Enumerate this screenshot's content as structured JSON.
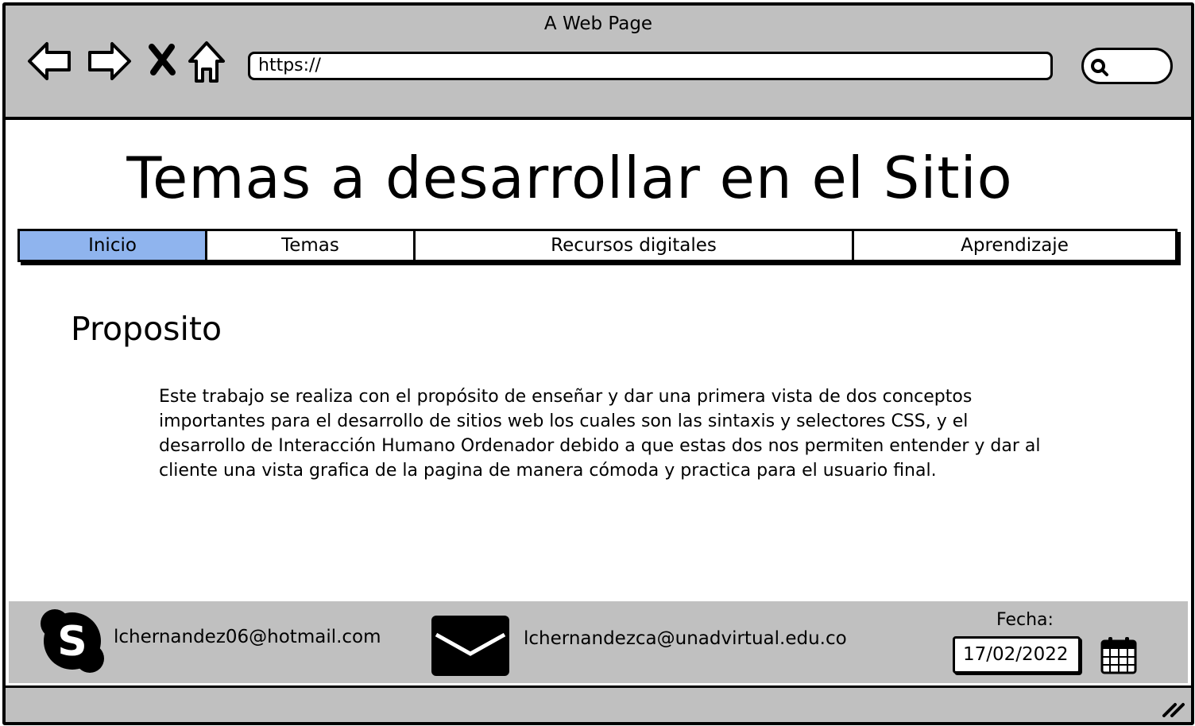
{
  "window": {
    "title": "A Web Page"
  },
  "browser": {
    "url": "https://",
    "icons": [
      "back-arrow-icon",
      "forward-arrow-icon",
      "close-x-icon",
      "home-icon",
      "search-icon"
    ]
  },
  "page": {
    "title": "Temas a desarrollar en el Sitio",
    "tabs": [
      {
        "label": "Inicio",
        "active": true
      },
      {
        "label": "Temas",
        "active": false
      },
      {
        "label": "Recursos digitales",
        "active": false
      },
      {
        "label": "Aprendizaje",
        "active": false
      }
    ],
    "section_heading": "Proposito",
    "paragraph": "Este trabajo se realiza con el propósito de enseñar y dar una primera vista de dos conceptos importantes para el desarrollo de sitios web los cuales son las sintaxis y selectores CSS, y el desarrollo de Interacción Humano Ordenador  debido a que estas dos nos permiten entender y dar al cliente una vista grafica de la pagina de manera cómoda y practica para el usuario final."
  },
  "footer": {
    "skype_email": "lchernandez06@hotmail.com",
    "mail_email": "lchernandezca@unadvirtual.edu.co",
    "date_label": "Fecha:",
    "date_value": "17/02/2022"
  },
  "colors": {
    "chrome": "#c0c0c0",
    "active_tab": "#8fb4ee",
    "ink": "#000000",
    "page": "#ffffff"
  }
}
